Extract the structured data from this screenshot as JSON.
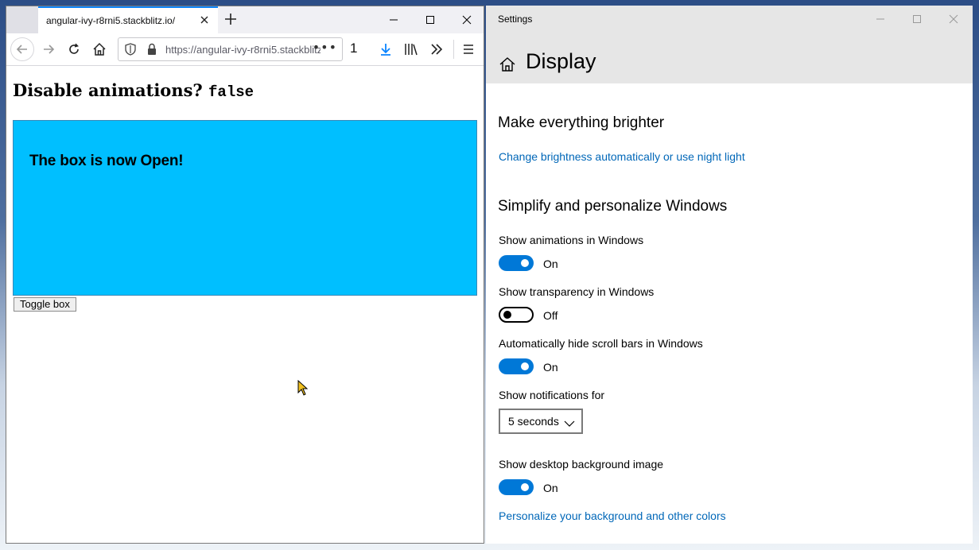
{
  "browser": {
    "tab_title": "angular-ivy-r8rni5.stackblitz.io/",
    "url": "https://angular-ivy-r8rni5.stackblitz.io",
    "tab_count": "1",
    "page": {
      "heading": "Disable animations?",
      "heading_value": "false",
      "box_text": "The box is now Open!",
      "toggle_button": "Toggle box"
    }
  },
  "settings": {
    "app_title": "Settings",
    "page_title": "Display",
    "section1_title": "Make everything brighter",
    "brightness_link": "Change brightness automatically or use night light",
    "section2_title": "Simplify and personalize Windows",
    "animations": {
      "label": "Show animations in Windows",
      "state": "On"
    },
    "transparency": {
      "label": "Show transparency in Windows",
      "state": "Off"
    },
    "scrollbars": {
      "label": "Automatically hide scroll bars in Windows",
      "state": "On"
    },
    "notifications": {
      "label": "Show notifications for",
      "value": "5 seconds"
    },
    "background_image": {
      "label": "Show desktop background image",
      "state": "On"
    },
    "personalize_link": "Personalize your background and other colors"
  },
  "colors": {
    "accent": "#0078d7",
    "link": "#0067b8",
    "box": "#00bfff",
    "firefox_tab_accent": "#0a84ff"
  }
}
